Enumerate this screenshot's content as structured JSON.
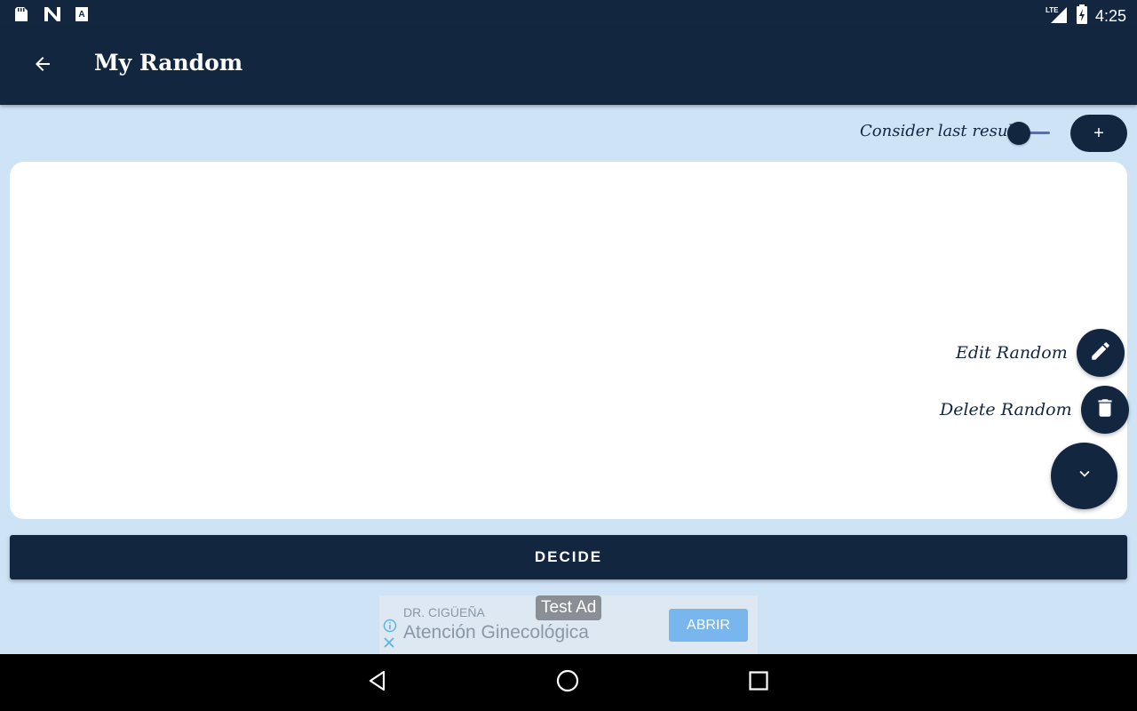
{
  "status_bar": {
    "network": "LTE",
    "time": "4:25",
    "left_icons": [
      "sd-card-icon",
      "n-logo-icon",
      "a-box-icon"
    ]
  },
  "app_bar": {
    "title": "My Random",
    "back_icon": "arrow-left-icon"
  },
  "controls": {
    "consider_label": "Consider last result?",
    "consider_toggle_on": false,
    "add_label": "+"
  },
  "fab_menu": {
    "edit_label": "Edit Random",
    "delete_label": "Delete Random",
    "edit_icon": "pencil-icon",
    "delete_icon": "trash-icon",
    "toggle_icon": "chevron-down-icon"
  },
  "decide_button": {
    "label": "DECIDE"
  },
  "ad": {
    "badge": "Test Ad",
    "advertiser": "DR. CIGÜEÑA",
    "title": "Atención Ginecológica",
    "cta": "ABRIR"
  },
  "colors": {
    "primary": "#132640",
    "background": "#cfe3f6",
    "card": "#ffffff"
  }
}
